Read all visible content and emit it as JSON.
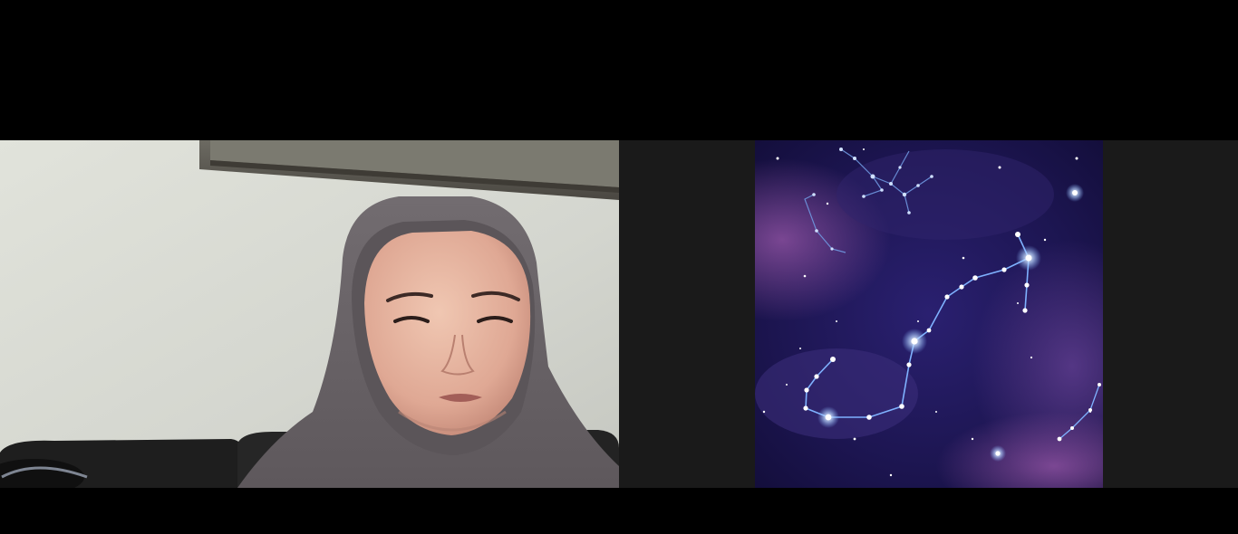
{
  "meeting": {
    "participants": [
      {
        "kind": "camera-video",
        "name": "",
        "icon": "person-video-feed-icon"
      },
      {
        "kind": "profile-picture",
        "name": "",
        "icon": "constellation-avatar-icon"
      }
    ]
  },
  "colors": {
    "background": "#000000",
    "tile_background": "#1a1a1a",
    "wall": "#d9dbd3",
    "hijab": "#6a6468",
    "sofa": "#1c1c1c",
    "sky_deep": "#1c1550",
    "sky_glow": "#5a3a8a",
    "star_line": "#7fb2ff"
  }
}
